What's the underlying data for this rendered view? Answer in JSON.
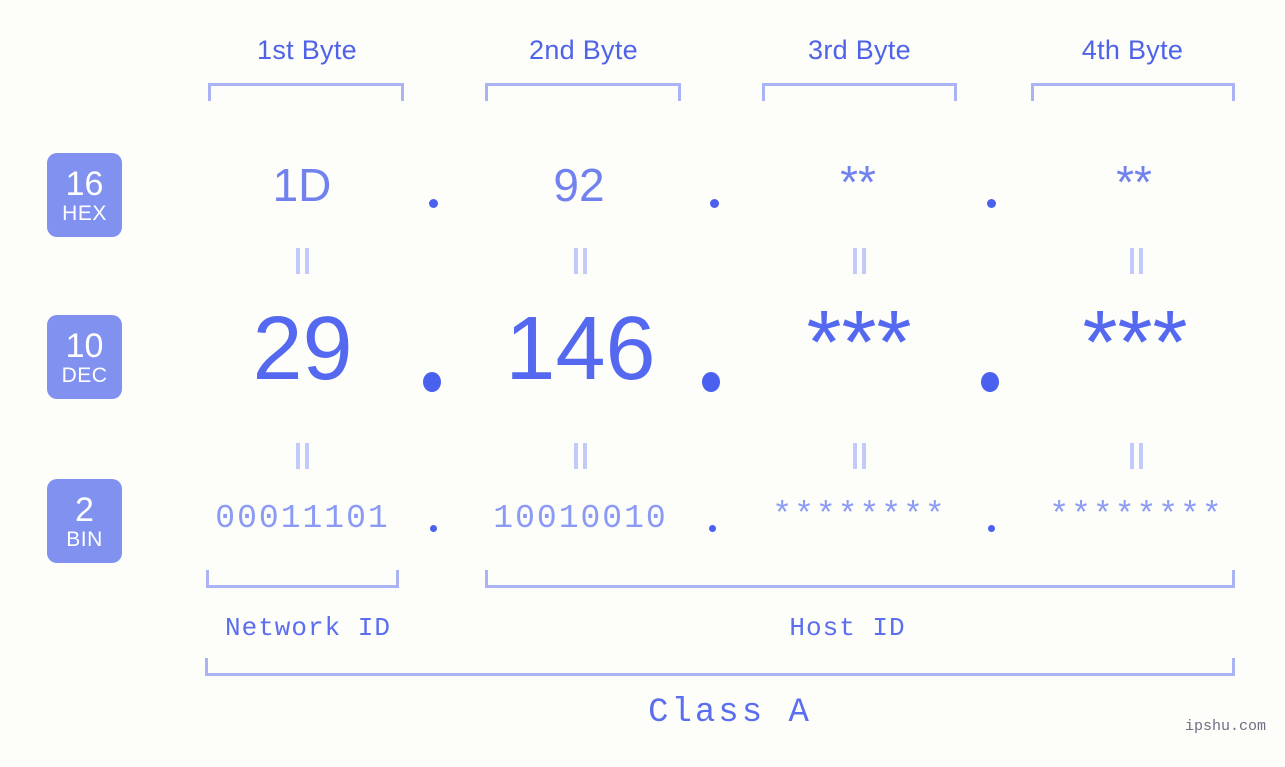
{
  "page": {
    "background_color": "#fdfdfa",
    "accent_color": "#5b6ef0",
    "badge_color": "#8091f0",
    "bracket_color": "#aab4f5",
    "watermark": "ipshu.com"
  },
  "byte_headers": [
    {
      "label": "1st Byte"
    },
    {
      "label": "2nd Byte"
    },
    {
      "label": "3rd Byte"
    },
    {
      "label": "4th Byte"
    }
  ],
  "rows": {
    "hex": {
      "badge_number": "16",
      "badge_name": "HEX",
      "values": [
        "1D",
        "92",
        "**",
        "**"
      ],
      "separator": "."
    },
    "dec": {
      "badge_number": "10",
      "badge_name": "DEC",
      "values": [
        "29",
        "146",
        "***",
        "***"
      ],
      "separator": "."
    },
    "bin": {
      "badge_number": "2",
      "badge_name": "BIN",
      "values": [
        "00011101",
        "10010010",
        "********",
        "********"
      ],
      "separator": "."
    }
  },
  "equality_marks": {
    "glyph": "||",
    "count_per_gap": 4,
    "gaps": 2
  },
  "id_sections": [
    {
      "label": "Network ID"
    },
    {
      "label": "Host ID"
    }
  ],
  "class_section": {
    "label": "Class A"
  }
}
